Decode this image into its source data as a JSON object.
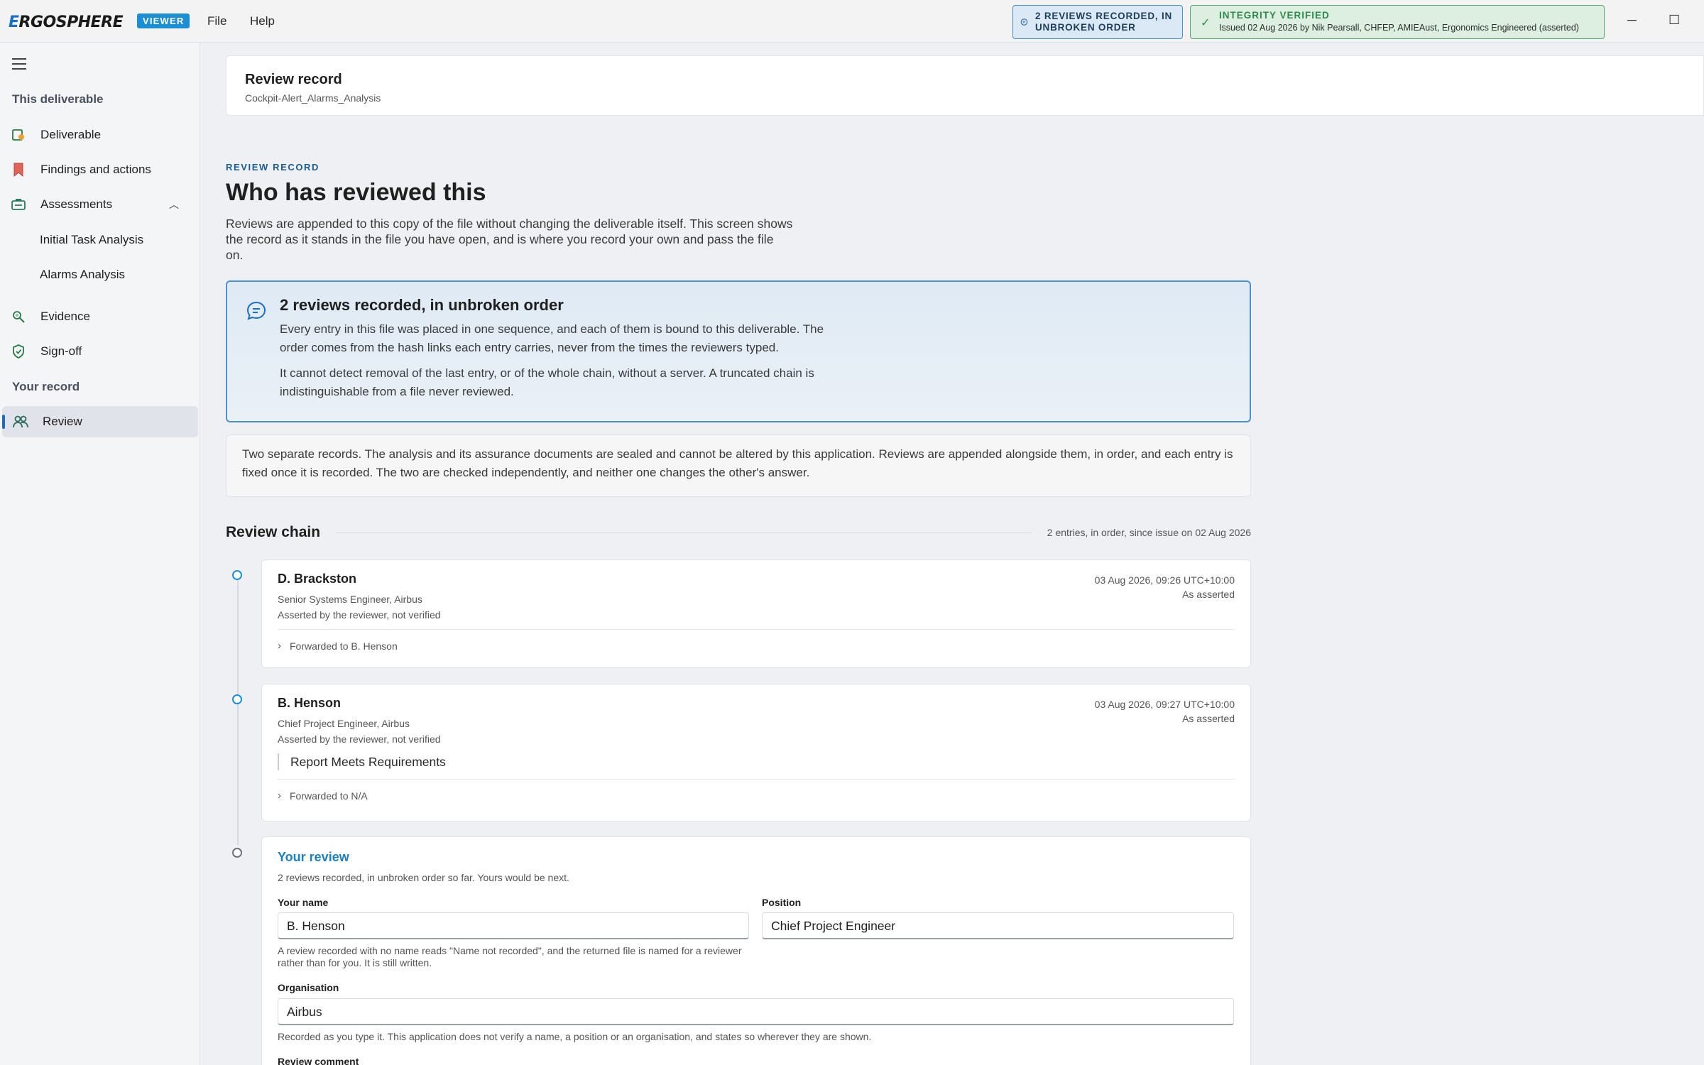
{
  "app": {
    "logo_prefix": "E",
    "logo_rest": "RGOSPHERE",
    "mode_badge": "VIEWER",
    "menu": [
      "File",
      "Help"
    ],
    "status_pill": "2 REVIEWS RECORDED, IN UNBROKEN ORDER",
    "integrity": {
      "title": "INTEGRITY VERIFIED",
      "detail": "Issued 02 Aug 2026 by Nik Pearsall, CHFEP, AMIEAust, Ergonomics Engineered (asserted)"
    },
    "colors": {
      "accent": "#1b8fd6",
      "verified": "#2e8a4a",
      "notice_border": "#4a93cf"
    }
  },
  "sidebar": {
    "section_deliverable": "This deliverable",
    "items": [
      {
        "label": "Deliverable",
        "icon": "deliverable-icon"
      },
      {
        "label": "Findings and actions",
        "icon": "bookmark-icon"
      },
      {
        "label": "Assessments",
        "icon": "assessments-icon"
      },
      {
        "label": "Initial Task Analysis"
      },
      {
        "label": "Alarms Analysis"
      },
      {
        "label": "Evidence",
        "icon": "evidence-icon"
      },
      {
        "label": "Sign-off",
        "icon": "shield-icon"
      },
      {
        "label": "Review",
        "icon": "people-icon"
      }
    ],
    "section_record": "Your record"
  },
  "header": {
    "title": "Review record",
    "subtitle": "Cockpit-Alert_Alarms_Analysis"
  },
  "main": {
    "eyebrow": "REVIEW RECORD",
    "title": "Who has reviewed this",
    "intro": "Reviews are appended to this copy of the file without changing the deliverable itself. This screen shows the record as it stands in the file you have open, and is where you record your own and pass the file on.",
    "notice": {
      "title": "2 reviews recorded, in unbroken order",
      "p1": "Every entry in this file was placed in one sequence, and each of them is bound to this deliverable. The order comes from the hash links each entry carries, never from the times the reviewers typed.",
      "p2": "It cannot detect removal of the last entry, or of the whole chain, without a server. A truncated chain is indistinguishable from a file never reviewed."
    },
    "separate_records": "Two separate records. The analysis and its assurance documents are sealed and cannot be altered by this application. Reviews are appended alongside them, in order, and each entry is fixed once it is recorded. The two are checked independently, and neither one changes the other's answer.",
    "chain": {
      "title": "Review chain",
      "meta": "2 entries, in order, since issue on 02 Aug 2026",
      "entries": [
        {
          "name": "D. Brackston",
          "role": "Senior Systems Engineer, Airbus",
          "asserted": "Asserted by the reviewer, not verified",
          "timestamp": "03 Aug 2026, 09:26 UTC+10:00",
          "time_status": "As asserted",
          "comment": "",
          "forwarded": "Forwarded to B. Henson"
        },
        {
          "name": "B. Henson",
          "role": "Chief Project Engineer, Airbus",
          "asserted": "Asserted by the reviewer, not verified",
          "timestamp": "03 Aug 2026, 09:27 UTC+10:00",
          "time_status": "As asserted",
          "comment": "Report Meets Requirements",
          "forwarded": "Forwarded to N/A"
        }
      ]
    },
    "your_review": {
      "title": "Your review",
      "subtitle": "2 reviews recorded, in unbroken order so far. Yours would be next.",
      "name_label": "Your name",
      "name_value": "B. Henson",
      "name_hint": "A review recorded with no name reads \"Name not recorded\", and the returned file is named for a reviewer rather than for you. It is still written.",
      "position_label": "Position",
      "position_value": "Chief Project Engineer",
      "org_label": "Organisation",
      "org_value": "Airbus",
      "org_hint": "Recorded as you type it. This application does not verify a name, a position or an organisation, and states so wherever they are shown.",
      "comment_label": "Review comment"
    }
  }
}
